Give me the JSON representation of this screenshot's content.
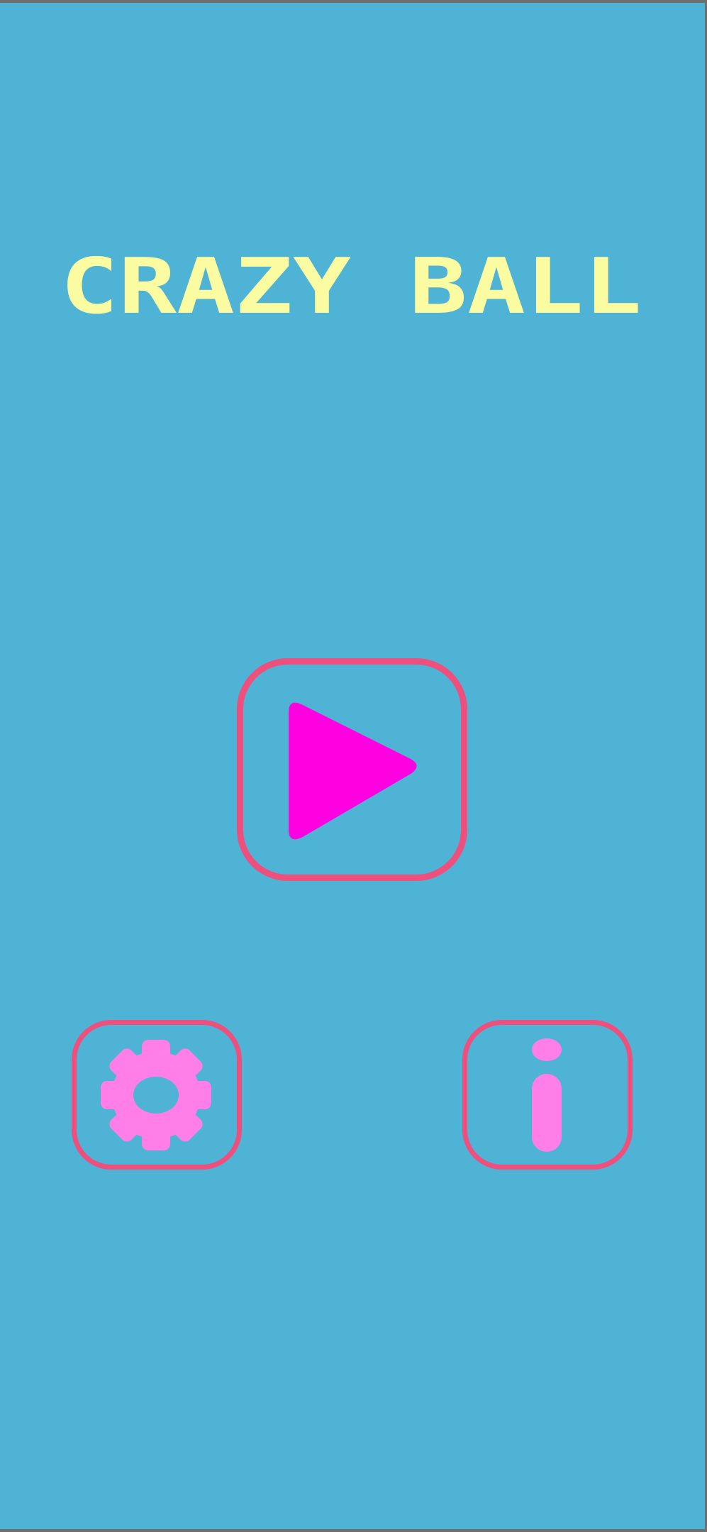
{
  "screen": {
    "title": "CRAZY BALL",
    "background_color": "#4fb3d6",
    "title_color": "#fbfca1",
    "button_border_color": "#ef4f7c"
  },
  "buttons": {
    "play": {
      "icon": "play-icon",
      "color": "#ff00e0"
    },
    "settings": {
      "icon": "gear-icon",
      "color": "#ff7ee8"
    },
    "info": {
      "icon": "info-icon",
      "color": "#ff7ee8"
    }
  }
}
